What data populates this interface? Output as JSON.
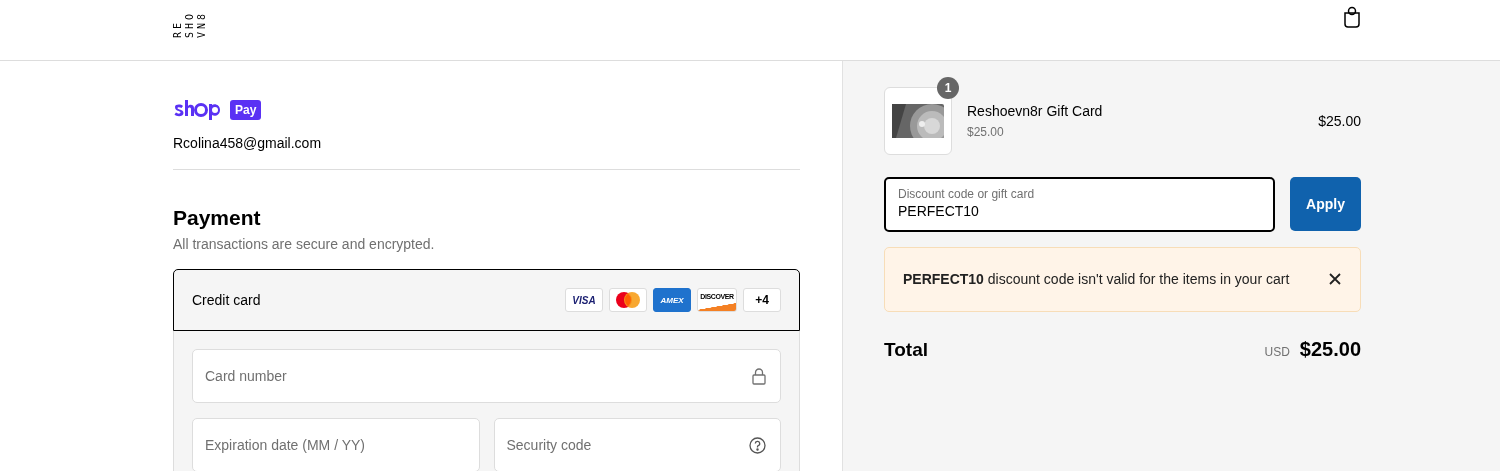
{
  "header": {
    "logo_lines": [
      "RE",
      "SHO",
      "VN8"
    ]
  },
  "contact": {
    "wallet_word": "Pay",
    "email": "Rcolina458@gmail.com"
  },
  "payment": {
    "title": "Payment",
    "subtitle": "All transactions are secure and encrypted.",
    "method": {
      "label": "Credit card",
      "selected": true,
      "brands": [
        {
          "kind": "visa",
          "label": "VISA"
        },
        {
          "kind": "mastercard"
        },
        {
          "kind": "amex",
          "label": "AMEX"
        },
        {
          "kind": "discover",
          "label": "DISCOVER"
        },
        {
          "kind": "more",
          "label": "+4"
        }
      ]
    },
    "fields": [
      {
        "placeholder": "Card number"
      },
      {
        "placeholder": "Expiration date (MM / YY)"
      },
      {
        "placeholder": "Security code"
      }
    ]
  },
  "summary": {
    "items": [
      {
        "name": "Reshoevn8r Gift Card",
        "unit_price": "$25.00",
        "quantity": "1",
        "price": "$25.00"
      }
    ],
    "discount": {
      "label": "Discount code or gift card",
      "value": "PERFECT10",
      "button": "Apply"
    },
    "notice": "**PERFECT10** discount code isn't valid for the items in your cart",
    "total": {
      "label": "Total",
      "currency": "USD",
      "amount": "$25.00"
    }
  }
}
